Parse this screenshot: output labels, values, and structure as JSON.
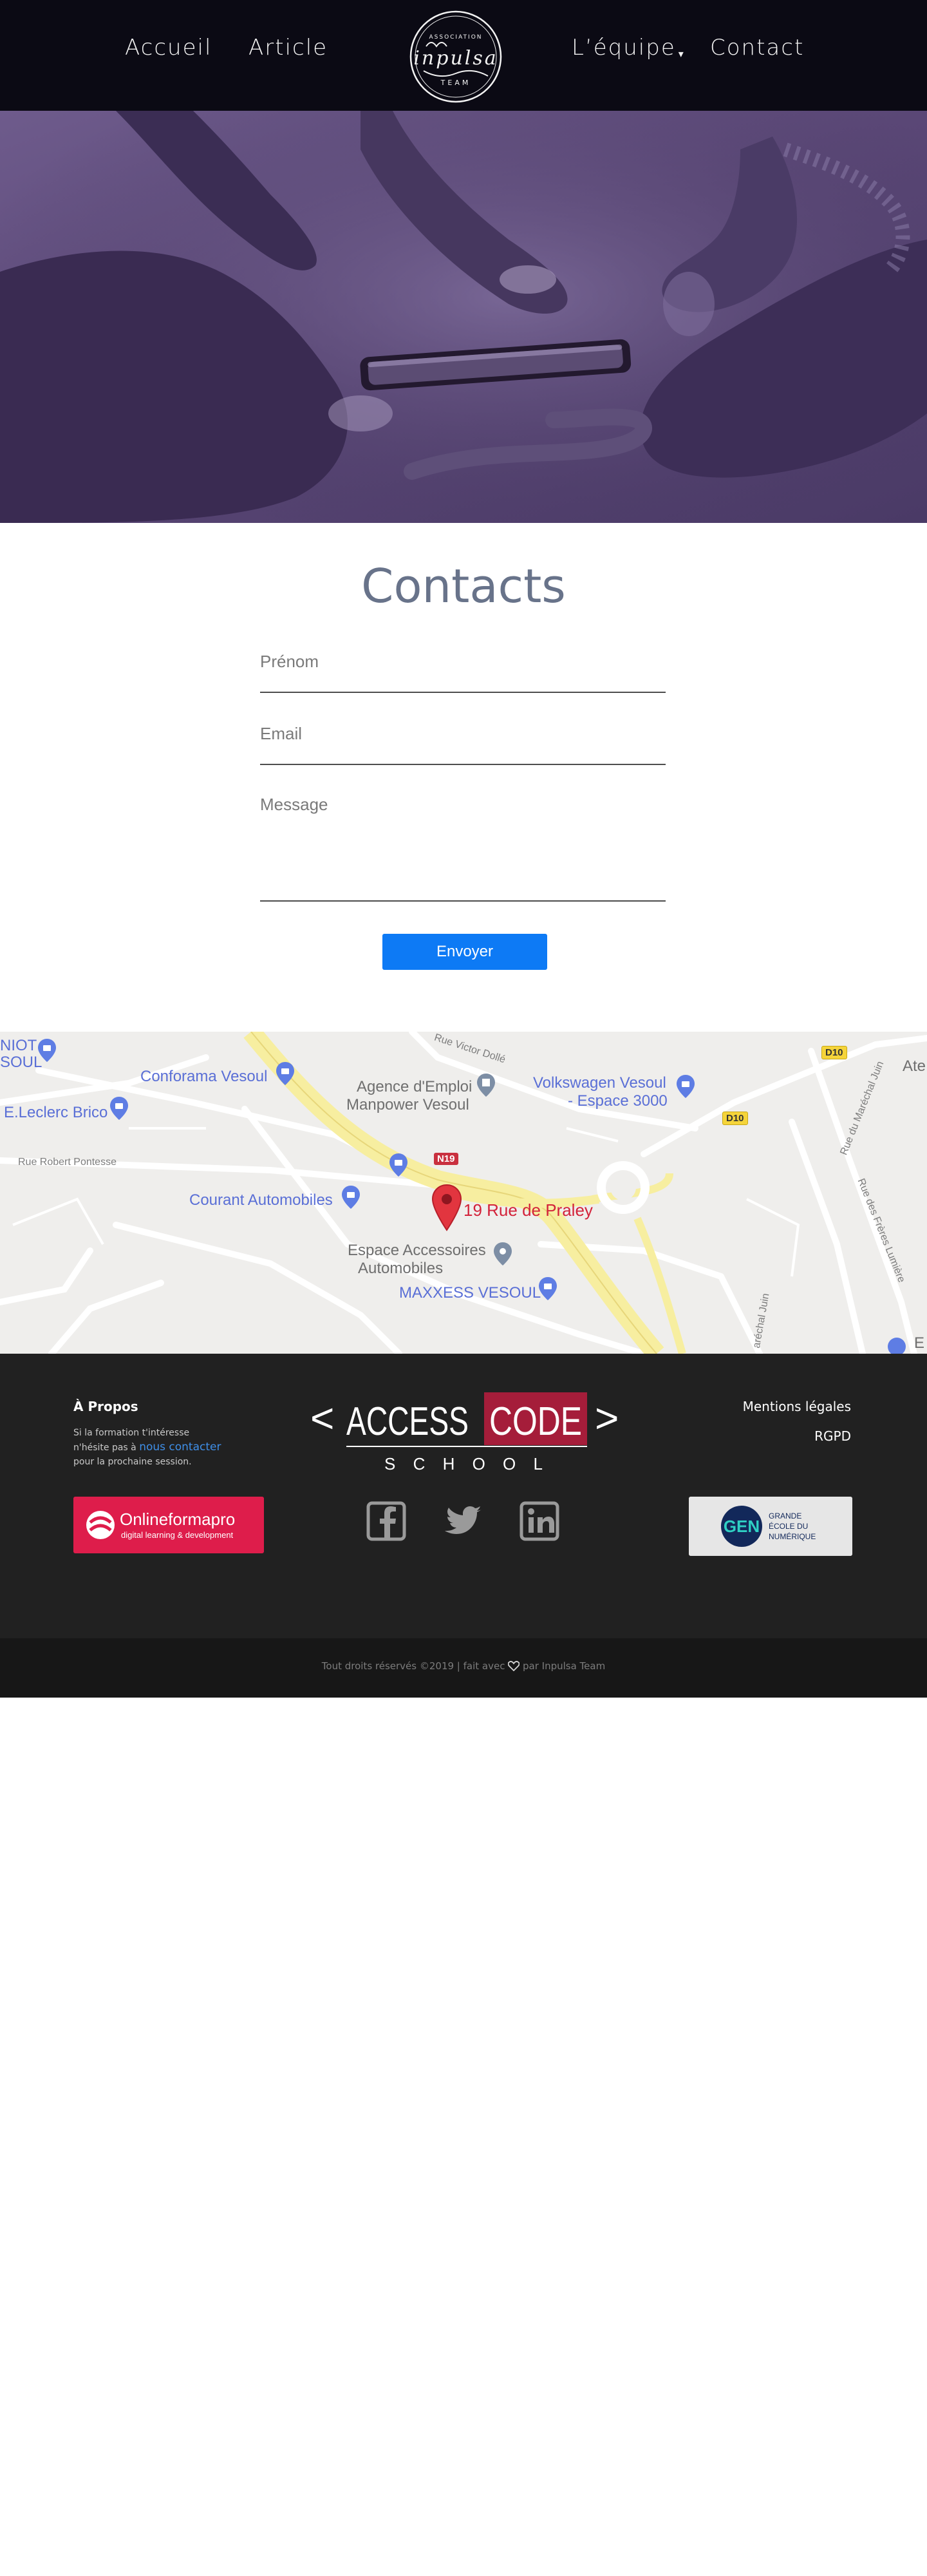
{
  "nav": {
    "items": [
      {
        "label": "Accueil"
      },
      {
        "label": "Article"
      },
      {
        "label": "L’équipe",
        "caret": "▾"
      },
      {
        "label": "Contact"
      }
    ],
    "logo": {
      "top_text": "ASSOCIATION",
      "name": "inpulsa",
      "bottom_text": "TEAM"
    }
  },
  "hero": {
    "image": "hands-holding-smartphone-photo",
    "overlay_color": "#5a4776"
  },
  "contact": {
    "title": "Contacts",
    "fields": {
      "firstname_placeholder": "Prénom",
      "email_placeholder": "Email",
      "message_placeholder": "Message"
    },
    "submit_label": "Envoyer"
  },
  "map": {
    "pin_label": "19 Rue de Praley",
    "places": [
      "NIOT",
      "SOUL",
      "Conforama Vesoul",
      "E.Leclerc Brico",
      "Agence d'Emploi",
      "Manpower Vesoul",
      "Volkswagen Vesoul",
      "- Espace 3000",
      "Courant Automobiles",
      "Espace Accessoires",
      "Automobiles",
      "MAXXESS VESOUL",
      "Ate",
      "E"
    ],
    "roads": [
      "Rue Victor Dollé",
      "Rue Robert Pontesse",
      "Rue du Maréchal Juin",
      "Rue des Frères Lumière",
      "aréchal Juin"
    ],
    "route_tags": [
      "N19",
      "D10",
      "D10"
    ]
  },
  "footer": {
    "about": {
      "title": "À Propos",
      "text_before": "Si la formation t'intéresse n'hésite pas à ",
      "link": "nous contacter",
      "text_after": " pour la prochaine session."
    },
    "brand": {
      "left_bracket": "<",
      "access": "ACCESS",
      "code": "CODE",
      "right_bracket": ">",
      "school": "S C H O O L"
    },
    "legal_links": [
      "Mentions légales",
      "RGPD"
    ],
    "partner_left": {
      "name": "Onlineformapro",
      "tagline": "digital learning & development"
    },
    "partner_right": {
      "line1": "GRANDE",
      "line2": "ÉCOLE DU",
      "line3": "NUMÉRIQUE"
    },
    "socials": [
      "facebook-icon",
      "twitter-icon",
      "linkedin-icon"
    ]
  },
  "copyright": {
    "before": "Tout droits réservés ©2019 | fait avec ",
    "after": " par Inpulsa Team"
  },
  "colors": {
    "nav_bg": "#0b0a14",
    "title": "#68738a",
    "button": "#0d7af5",
    "footer_bg": "#212121",
    "bottom_bg": "#171717",
    "code_red": "#a51d3a"
  }
}
